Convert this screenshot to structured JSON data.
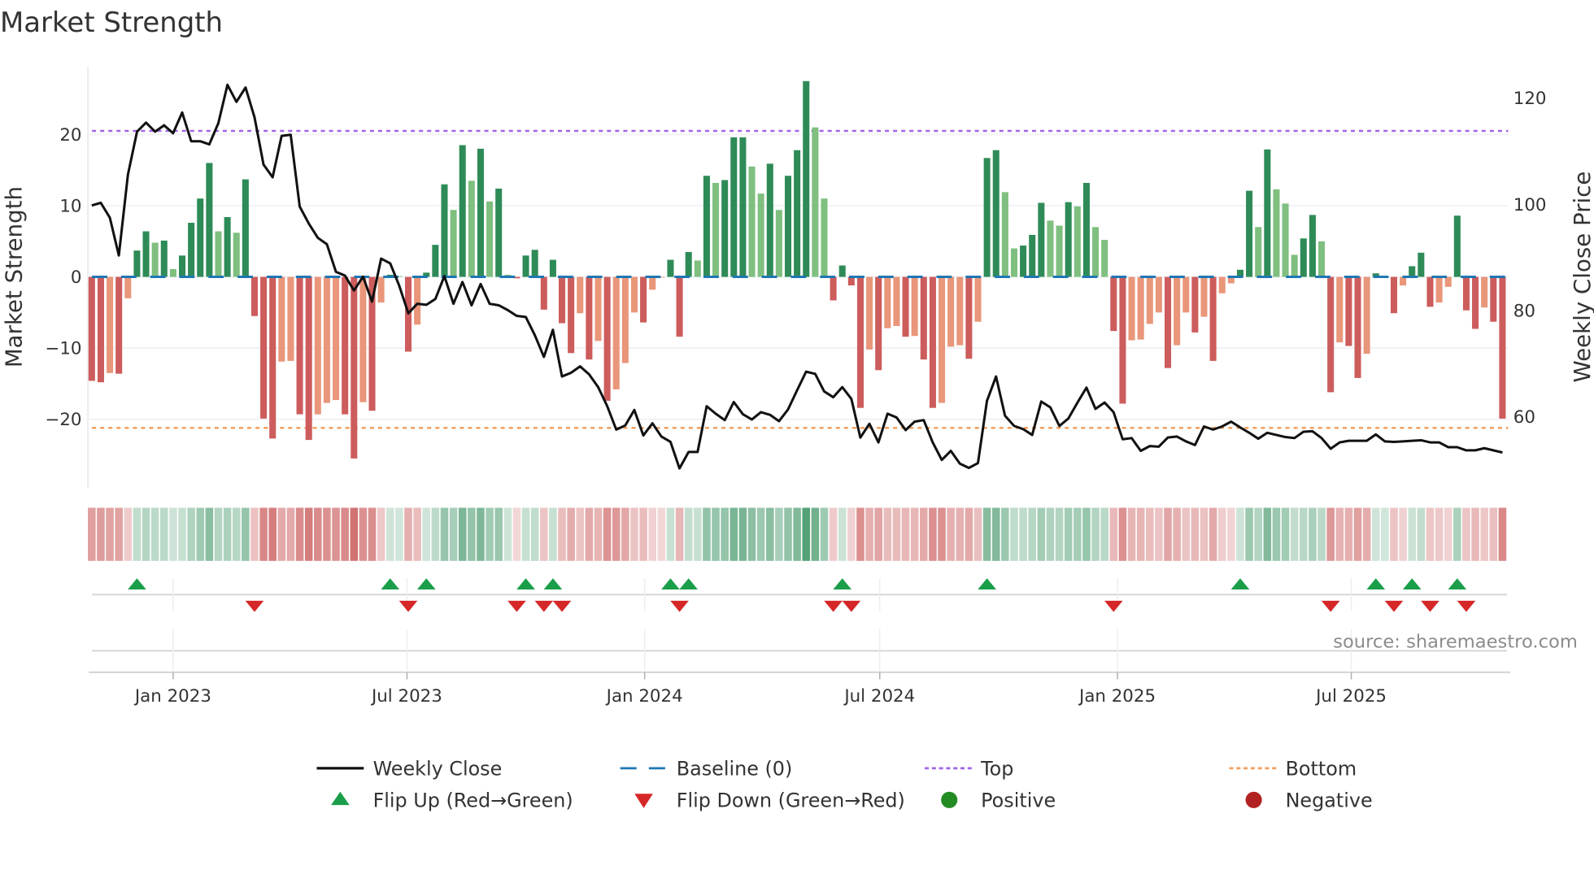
{
  "chart_data": {
    "type": "bar",
    "title": "Market Strength",
    "ylabel": "Market Strength",
    "y2label": "Weekly Close Price",
    "xlabel": "",
    "x_start_week": "2022-10-30",
    "x_frequency": "weekly",
    "ylim": [
      -30,
      30
    ],
    "y2lim": [
      46.3,
      127.4
    ],
    "yticks": [
      -20,
      -10,
      0,
      10,
      20
    ],
    "ytick_labels": [
      "−20",
      "−10",
      "0",
      "10",
      "20"
    ],
    "y2ticks": [
      60,
      80,
      100,
      120
    ],
    "y2tick_labels": [
      "60",
      "80",
      "100",
      "120"
    ],
    "xticks": [
      {
        "date": "2023-01-01",
        "label": "Jan 2023"
      },
      {
        "date": "2023-07-01",
        "label": "Jul 2023"
      },
      {
        "date": "2024-01-01",
        "label": "Jan 2024"
      },
      {
        "date": "2024-07-01",
        "label": "Jul 2024"
      },
      {
        "date": "2025-01-01",
        "label": "Jan 2025"
      },
      {
        "date": "2025-07-01",
        "label": "Jul 2025"
      }
    ],
    "grid": true,
    "top_level": 20.5,
    "bottom_level": -21.2,
    "baseline": 0,
    "strength": [
      -14.6,
      -14.8,
      -13.5,
      -13.6,
      -3.0,
      3.7,
      6.4,
      4.8,
      5.1,
      1.1,
      3.0,
      7.6,
      11.0,
      16.0,
      6.4,
      8.4,
      6.2,
      13.7,
      -5.5,
      -19.9,
      -22.7,
      -11.9,
      -11.8,
      -19.3,
      -22.9,
      -19.3,
      -17.7,
      -17.3,
      -19.3,
      -25.5,
      -17.6,
      -18.8,
      -3.6,
      0.3,
      0.1,
      -10.5,
      -6.7,
      0.6,
      4.5,
      13.0,
      9.4,
      18.5,
      13.5,
      18.0,
      10.6,
      12.4,
      0.3,
      -0.2,
      3.0,
      3.8,
      -4.6,
      2.4,
      -6.5,
      -10.7,
      -5.1,
      -11.6,
      -9.0,
      -17.4,
      -15.8,
      -12.1,
      -5.0,
      -6.4,
      -1.8,
      -0.1,
      2.4,
      -8.4,
      3.5,
      2.3,
      14.2,
      13.2,
      13.6,
      19.6,
      19.6,
      15.5,
      11.7,
      15.9,
      9.4,
      14.2,
      17.8,
      27.5,
      21.0,
      11.0,
      -3.3,
      1.6,
      -1.2,
      -18.4,
      -10.2,
      -13.1,
      -7.2,
      -6.9,
      -8.4,
      -8.3,
      -11.6,
      -18.4,
      -17.7,
      -9.8,
      -9.6,
      -11.5,
      -6.3,
      16.7,
      17.8,
      11.9,
      4.0,
      4.4,
      5.9,
      10.4,
      7.9,
      7.2,
      10.5,
      9.9,
      13.2,
      7.0,
      5.2,
      -7.6,
      -17.8,
      -8.9,
      -8.8,
      -6.6,
      -5.0,
      -12.8,
      -9.6,
      -5.0,
      -7.8,
      -5.6,
      -11.8,
      -2.3,
      -0.9,
      1.0,
      12.1,
      7.0,
      17.9,
      12.3,
      10.3,
      3.1,
      5.4,
      8.7,
      5.0,
      -16.2,
      -9.2,
      -9.7,
      -14.2,
      -10.8,
      0.5,
      0.1,
      -5.1,
      -1.2,
      1.5,
      3.4,
      -4.2,
      -3.6,
      -1.4,
      8.6,
      -4.7,
      -7.3,
      -4.3,
      -6.3,
      -19.9
    ],
    "weekly_close": [
      99.6,
      100.1,
      97.3,
      90.2,
      105.4,
      113.5,
      115.2,
      113.5,
      114.7,
      113.2,
      117.1,
      111.7,
      111.7,
      111.1,
      115.1,
      122.3,
      119.1,
      121.8,
      116.2,
      107.3,
      104.9,
      112.7,
      112.9,
      99.4,
      96.2,
      93.5,
      92.3,
      87.1,
      86.4,
      83.6,
      86.2,
      81.5,
      89.6,
      88.7,
      84.5,
      79.3,
      81.1,
      80.9,
      82.0,
      86.3,
      81.1,
      85.2,
      80.8,
      84.8,
      81.1,
      80.8,
      79.9,
      78.8,
      78.6,
      75.2,
      71.1,
      76.2,
      67.4,
      68.1,
      69.3,
      67.8,
      65.4,
      61.8,
      57.4,
      58.2,
      61.1,
      56.3,
      58.6,
      56.1,
      55.1,
      50.1,
      53.2,
      53.2,
      61.8,
      60.4,
      59.2,
      62.6,
      60.3,
      59.3,
      60.7,
      60.2,
      59.0,
      61.2,
      64.8,
      68.3,
      67.9,
      64.6,
      63.5,
      65.4,
      63.2,
      55.9,
      58.5,
      55.0,
      60.4,
      59.7,
      57.3,
      58.9,
      59.2,
      55.0,
      51.7,
      53.4,
      51.0,
      50.2,
      51.1,
      62.8,
      67.4,
      60.0,
      58.1,
      57.5,
      56.4,
      62.7,
      61.6,
      58.1,
      59.5,
      62.5,
      65.3,
      61.3,
      62.5,
      60.7,
      55.6,
      55.8,
      53.4,
      54.3,
      54.2,
      55.9,
      56.1,
      55.2,
      54.5,
      58.0,
      57.4,
      58.0,
      58.9,
      57.8,
      56.8,
      55.7,
      56.8,
      56.4,
      56.0,
      55.8,
      57.0,
      57.1,
      55.8,
      53.8,
      55.0,
      55.3,
      55.3,
      55.3,
      56.5,
      55.2,
      55.1,
      55.2,
      55.3,
      55.4,
      55.0,
      55.0,
      54.1,
      54.1,
      53.5,
      53.5,
      53.9,
      53.5,
      53.1
    ],
    "colors": {
      "pos_strong": "#2e8b57",
      "pos_weak": "#7fbf7f",
      "neg_strong": "#cd5c5c",
      "neg_weak": "#e9967a",
      "close": "#111111",
      "baseline": "#1f77b4",
      "top": "#a066e8",
      "bottom": "#f0a060",
      "flip_up": "#1a9e4a",
      "flip_down": "#d62728",
      "positive": "#228b22",
      "negative": "#b22222"
    },
    "legend_position": "bottom",
    "legend": [
      {
        "key": "close",
        "label": "Weekly Close"
      },
      {
        "key": "baseline",
        "label": "Baseline (0)"
      },
      {
        "key": "top",
        "label": "Top"
      },
      {
        "key": "bottom",
        "label": "Bottom"
      },
      {
        "key": "flip_up",
        "label": "Flip Up (Red→Green)"
      },
      {
        "key": "flip_down",
        "label": "Flip Down (Green→Red)"
      },
      {
        "key": "positive",
        "label": "Positive"
      },
      {
        "key": "negative",
        "label": "Negative"
      }
    ],
    "source": "source: sharemaestro.com"
  }
}
